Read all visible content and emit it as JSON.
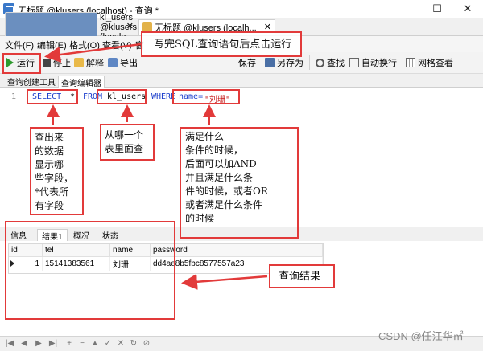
{
  "window": {
    "title": "无标题 @klusers (localhost) - 查询 *",
    "minimize": "—",
    "maximize": "☐",
    "close": "✕"
  },
  "tabs": [
    {
      "label": "kl_users @klusers (localh...",
      "close": "✕"
    },
    {
      "label": "无标题 @klusers (localh...",
      "close": "✕"
    }
  ],
  "menu": [
    "文件(F)",
    "编辑(E)",
    "格式(O)",
    "查看(V)",
    "窗"
  ],
  "toolbar": {
    "run": "运行",
    "stop": "停止",
    "explain": "解释",
    "export": "导出",
    "save": "保存",
    "save_as": "另存为",
    "find": "查找",
    "autowrap": "自动换行",
    "grid_view": "网格查看"
  },
  "subtabs": [
    "查询创建工具",
    "查询编辑器"
  ],
  "editor": {
    "line_number": "1",
    "sql_tokens": {
      "select": "SELECT",
      "star": "*",
      "from": "FROM",
      "table": "kl_users",
      "where": "WHERE",
      "condition": "name=",
      "value": "\"刘珊\""
    }
  },
  "annotations": {
    "top": "写完SQL查询语句后点击运行",
    "select": "查出来\n的数据\n显示哪\n些字段，\n*代表所\n有字段",
    "from": "从哪一个\n表里面查",
    "where": "满足什么\n条件的时候，\n后面可以加AND\n并且满足什么条\n件的时候，或者OR\n或者满足什么条件\n的时候",
    "result": "查询结果"
  },
  "result_tabs": [
    "信息",
    "结果1",
    "概况",
    "状态"
  ],
  "result_grid": {
    "columns": [
      "id",
      "tel",
      "name",
      "password"
    ],
    "rows": [
      {
        "id": "1",
        "tel": "15141383561",
        "name": "刘珊",
        "password": "dd4ae8b5fbc8577557a23"
      }
    ]
  },
  "navbar": [
    "|◀",
    "◀",
    "▶",
    "▶|",
    "+",
    "−",
    "▲",
    "✓",
    "✕",
    "↻",
    "⊘"
  ],
  "watermark": "CSDN @任江华㎡",
  "colors": {
    "annotation_red": "#e23a3a",
    "keyword_blue": "#1a3dcc",
    "string_red": "#c81c1c"
  }
}
